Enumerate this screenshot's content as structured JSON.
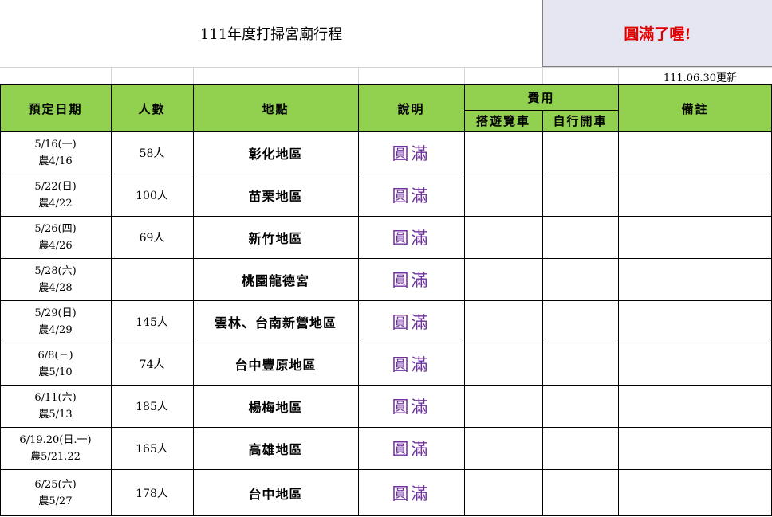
{
  "title": "111年度打掃宮廟行程",
  "banner": "圓滿了喔!",
  "updated": "111.06.30更新",
  "headers": {
    "date": "預定日期",
    "people": "人數",
    "place": "地點",
    "note": "說明",
    "fee": "費用",
    "fee_bus": "搭遊覽車",
    "fee_self": "自行開車",
    "remark": "備註"
  },
  "rows": [
    {
      "date": "5/16(一)",
      "lunar": "農4/16",
      "people": "58人",
      "place": "彰化地區",
      "status": "圓滿"
    },
    {
      "date": "5/22(日)",
      "lunar": "農4/22",
      "people": "100人",
      "place": "苗栗地區",
      "status": "圓滿"
    },
    {
      "date": "5/26(四)",
      "lunar": "農4/26",
      "people": "69人",
      "place": "新竹地區",
      "status": "圓滿"
    },
    {
      "date": "5/28(六)",
      "lunar": "農4/28",
      "people": "",
      "place": "桃園龍德宮",
      "status": "圓滿"
    },
    {
      "date": "5/29(日)",
      "lunar": "農4/29",
      "people": "145人",
      "place": "雲林、台南新營地區",
      "status": "圓滿"
    },
    {
      "date": "6/8(三)",
      "lunar": "農5/10",
      "people": "74人",
      "place": "台中豐原地區",
      "status": "圓滿"
    },
    {
      "date": "6/11(六)",
      "lunar": "農5/13",
      "people": "185人",
      "place": "楊梅地區",
      "status": "圓滿"
    },
    {
      "date": "6/19.20(日.一)",
      "lunar": "農5/21.22",
      "people": "165人",
      "place": "高雄地區",
      "status": "圓滿"
    },
    {
      "date": "6/25(六)",
      "lunar": "農5/27",
      "people": "178人",
      "place": "台中地區",
      "status": "圓滿"
    }
  ],
  "colors": {
    "header_bg": "#92d050",
    "banner_bg": "#e6e6f2",
    "banner_text": "#e00000",
    "status_text": "#7030a0"
  }
}
